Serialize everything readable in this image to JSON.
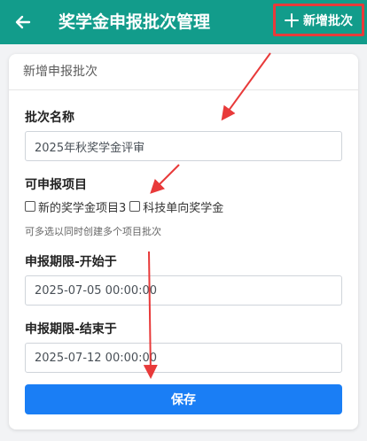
{
  "header": {
    "title": "奖学金申报批次管理",
    "add_batch_label": "新增批次"
  },
  "card": {
    "title": "新增申报批次",
    "name_field": {
      "label": "批次名称",
      "value": "2025年秋奖学金评审"
    },
    "projects": {
      "label": "可申报项目",
      "options": [
        {
          "label": "新的奖学金项目3",
          "checked": false
        },
        {
          "label": "科技单向奖学金",
          "checked": false
        }
      ],
      "hint": "可多选以同时创建多个项目批次"
    },
    "start": {
      "label": "申报期限-开始于",
      "value": "2025-07-05 00:00:00"
    },
    "end": {
      "label": "申报期限-结束于",
      "value": "2025-07-12 00:00:00"
    },
    "save_label": "保存"
  },
  "colors": {
    "appbar": "#129c8b",
    "primary_button": "#1a7ef5",
    "annotation": "#e83a3a"
  }
}
